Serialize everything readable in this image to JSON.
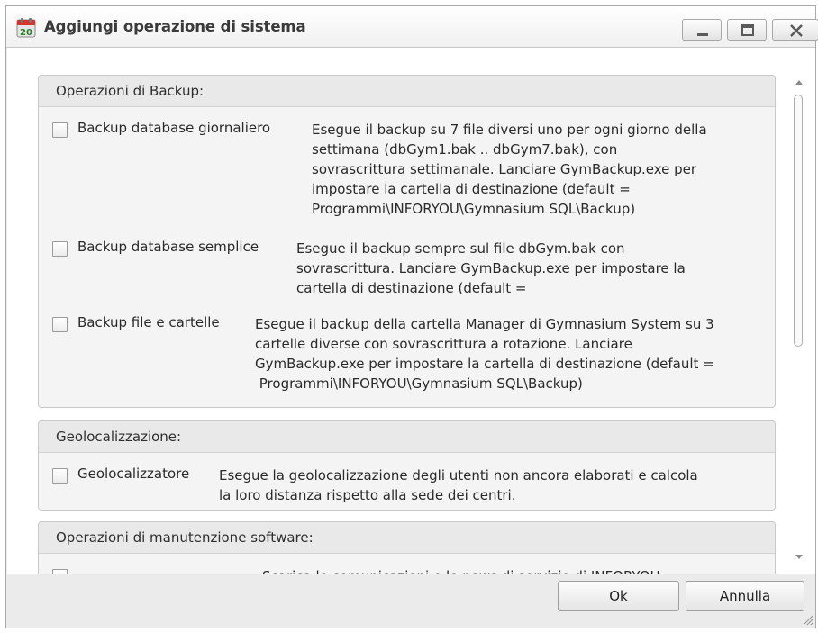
{
  "window": {
    "title": "Aggiungi operazione di sistema",
    "icon": "calendar-icon"
  },
  "groups": [
    {
      "header": "Operazioni di Backup:",
      "items": [
        {
          "label": "Backup database giornaliero",
          "checked": false,
          "desc": [
            "Esegue il backup su 7 file diversi uno per ogni giorno della",
            "settimana (dbGym1.bak .. dbGym7.bak), con",
            "sovrascrittura settimanale. Lanciare GymBackup.exe per",
            "impostare la cartella di destinazione (default =",
            "Programmi\\INFORYOU\\Gymnasium SQL\\Backup)"
          ]
        },
        {
          "label": "Backup database semplice",
          "checked": false,
          "desc": [
            "Esegue il backup sempre sul file dbGym.bak con",
            "sovrascrittura. Lanciare GymBackup.exe per impostare la",
            "cartella di destinazione (default ="
          ]
        },
        {
          "label": "Backup file e cartelle",
          "checked": false,
          "desc": [
            "Esegue il backup della cartella Manager di Gymnasium System su 3",
            "cartelle diverse con sovrascrittura a rotazione. Lanciare",
            "GymBackup.exe per impostare la cartella di destinazione (default =",
            " Programmi\\INFORYOU\\Gymnasium SQL\\Backup)"
          ]
        }
      ]
    },
    {
      "header": "Geolocalizzazione:",
      "items": [
        {
          "label": "Geolocalizzatore",
          "checked": false,
          "desc": [
            "Esegue la geolocalizzazione degli utenti non ancora elaborati e calcola",
            "la loro distanza rispetto alla sede dei centri."
          ]
        }
      ]
    },
    {
      "header": "Operazioni di manutenzione software:",
      "items": [
        {
          "label": "",
          "checked": false,
          "desc": [
            "Scarica le comunicazioni e le news di servizio di INFORYOU"
          ]
        }
      ]
    }
  ],
  "buttons": {
    "ok": "Ok",
    "cancel": "Annulla"
  }
}
